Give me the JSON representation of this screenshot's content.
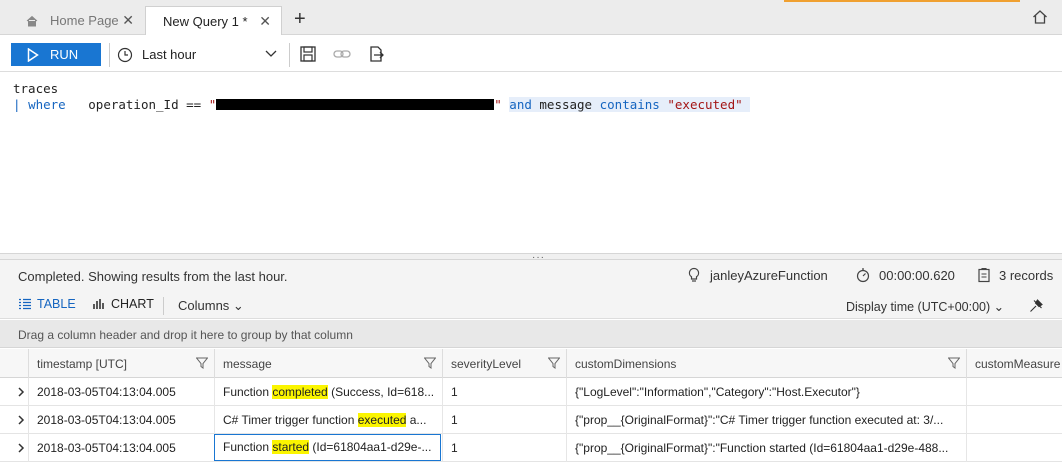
{
  "tabs": {
    "home_label": "Home Page",
    "query_label": "New Query 1 *",
    "close_glyph": "✕",
    "add_glyph": "+"
  },
  "toolbar": {
    "run_label": "RUN",
    "time_range": "Last hour"
  },
  "editor": {
    "line1": "traces",
    "line2_pipe": "|",
    "line2_kw_where": "where",
    "line2_field": "operation_Id ==",
    "line2_quote_open": "\"",
    "line2_quote_close": "\"",
    "line2_and": "and",
    "line2_message": "message",
    "line2_contains": "contains",
    "line2_value": "\"executed\""
  },
  "splitter": {
    "grip": "···"
  },
  "status": {
    "message": "Completed. Showing results from the last hour.",
    "app_name": "janleyAzureFunction",
    "duration": "00:00:00.620",
    "record_count": "3 records"
  },
  "view": {
    "table_label": "TABLE",
    "chart_label": "CHART",
    "columns_label": "Columns ⌄",
    "display_time_label": "Display time (UTC+00:00) ⌄"
  },
  "group_hint": "Drag a column header and drop it here to group by that column",
  "grid": {
    "columns": [
      "timestamp [UTC]",
      "message",
      "severityLevel",
      "customDimensions",
      "customMeasure"
    ],
    "rows": [
      {
        "timestamp": "2018-03-05T04:13:04.005",
        "message_pre": "Function ",
        "message_hl": "completed",
        "message_post": " (Success, Id=618...",
        "severity": "1",
        "dimensions": "{\"LogLevel\":\"Information\",\"Category\":\"Host.Executor\"}"
      },
      {
        "timestamp": "2018-03-05T04:13:04.005",
        "message_pre": "C# Timer trigger function ",
        "message_hl": "executed",
        "message_post": " a...",
        "severity": "1",
        "dimensions": "{\"prop__{OriginalFormat}\":\"C# Timer trigger function executed at: 3/..."
      },
      {
        "timestamp": "2018-03-05T04:13:04.005",
        "message_pre": "Function ",
        "message_hl": "started",
        "message_post": " (Id=61804aa1-d29e-...",
        "severity": "1",
        "dimensions": "{\"prop__{OriginalFormat}\":\"Function started (Id=61804aa1-d29e-488..."
      }
    ]
  },
  "colors": {
    "accent": "#1976d2",
    "highlight": "#fbf500",
    "keyword": "#1565c0",
    "string": "#a31515"
  }
}
